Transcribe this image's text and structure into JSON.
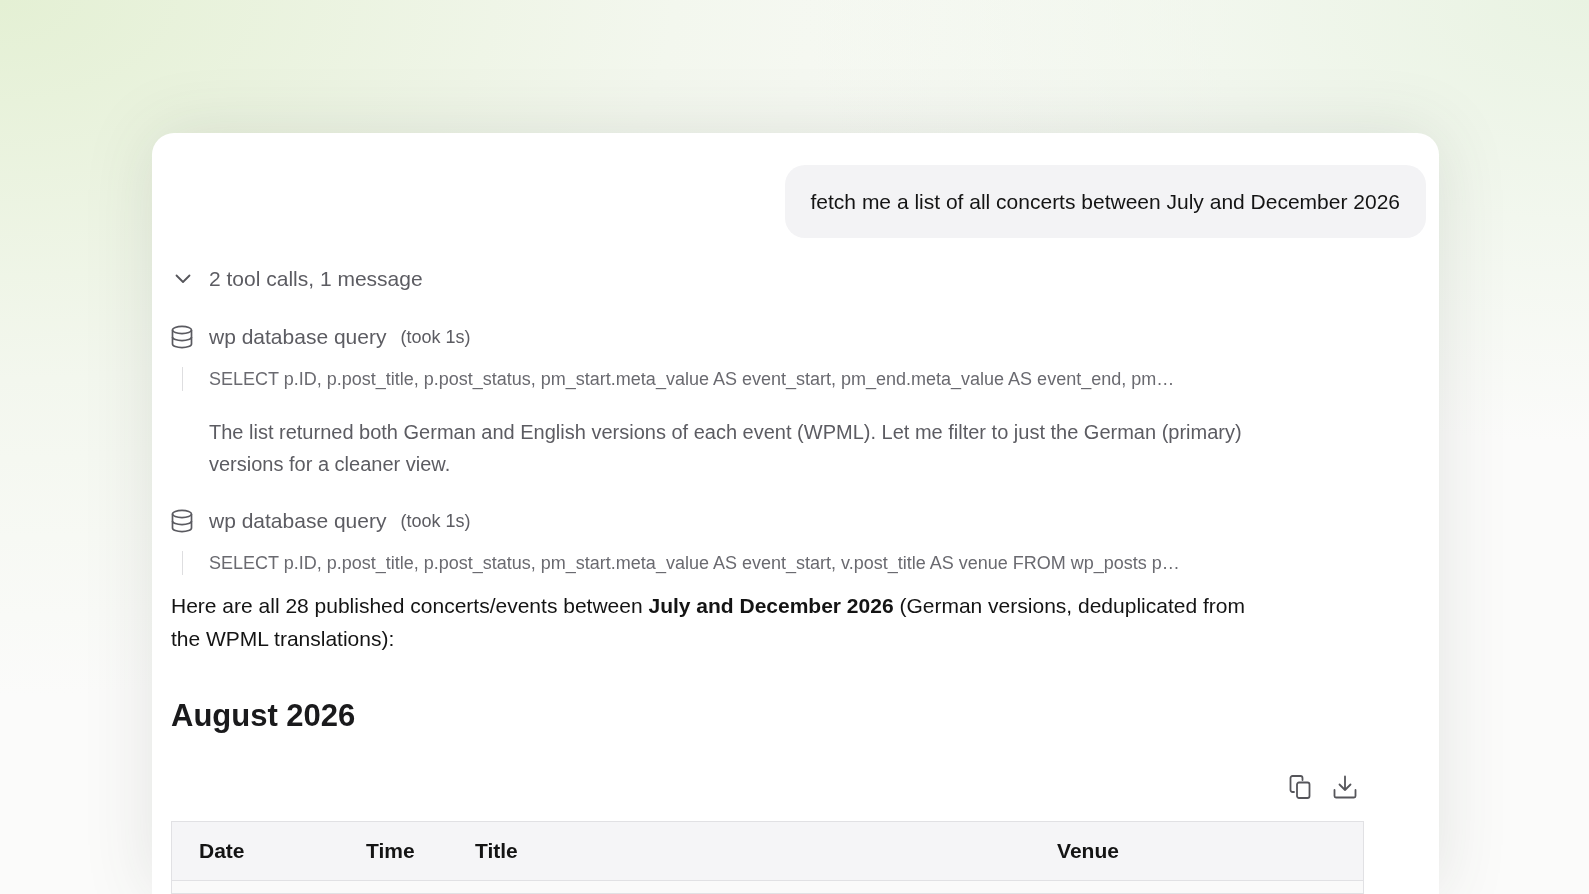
{
  "user_message": {
    "text": "fetch me a list of all concerts between July and December 2026"
  },
  "tool_summary": {
    "label": "2 tool calls, 1 message",
    "expanded": true
  },
  "steps": [
    {
      "kind": "tool",
      "name": "wp database query",
      "duration": "(took 1s)",
      "query": "SELECT p.ID, p.post_title, p.post_status, pm_start.meta_value AS event_start, pm_end.meta_value AS event_end, pm…"
    },
    {
      "kind": "message",
      "text": "The list returned both German and English versions of each event (WPML). Let me filter to just the German (primary) versions for a cleaner view."
    },
    {
      "kind": "tool",
      "name": "wp database query",
      "duration": "(took 1s)",
      "query": "SELECT p.ID, p.post_title, p.post_status, pm_start.meta_value AS event_start, v.post_title AS venue FROM wp_posts p…"
    }
  ],
  "answer": {
    "intro": "Here are all 28 published concerts/events between **July and December 2026** (German versions, deduplicated from the WPML translations):"
  },
  "sections": [
    {
      "heading": "August 2026",
      "table": {
        "columns": [
          "Date",
          "Time",
          "Title",
          "Venue"
        ]
      }
    }
  ]
}
